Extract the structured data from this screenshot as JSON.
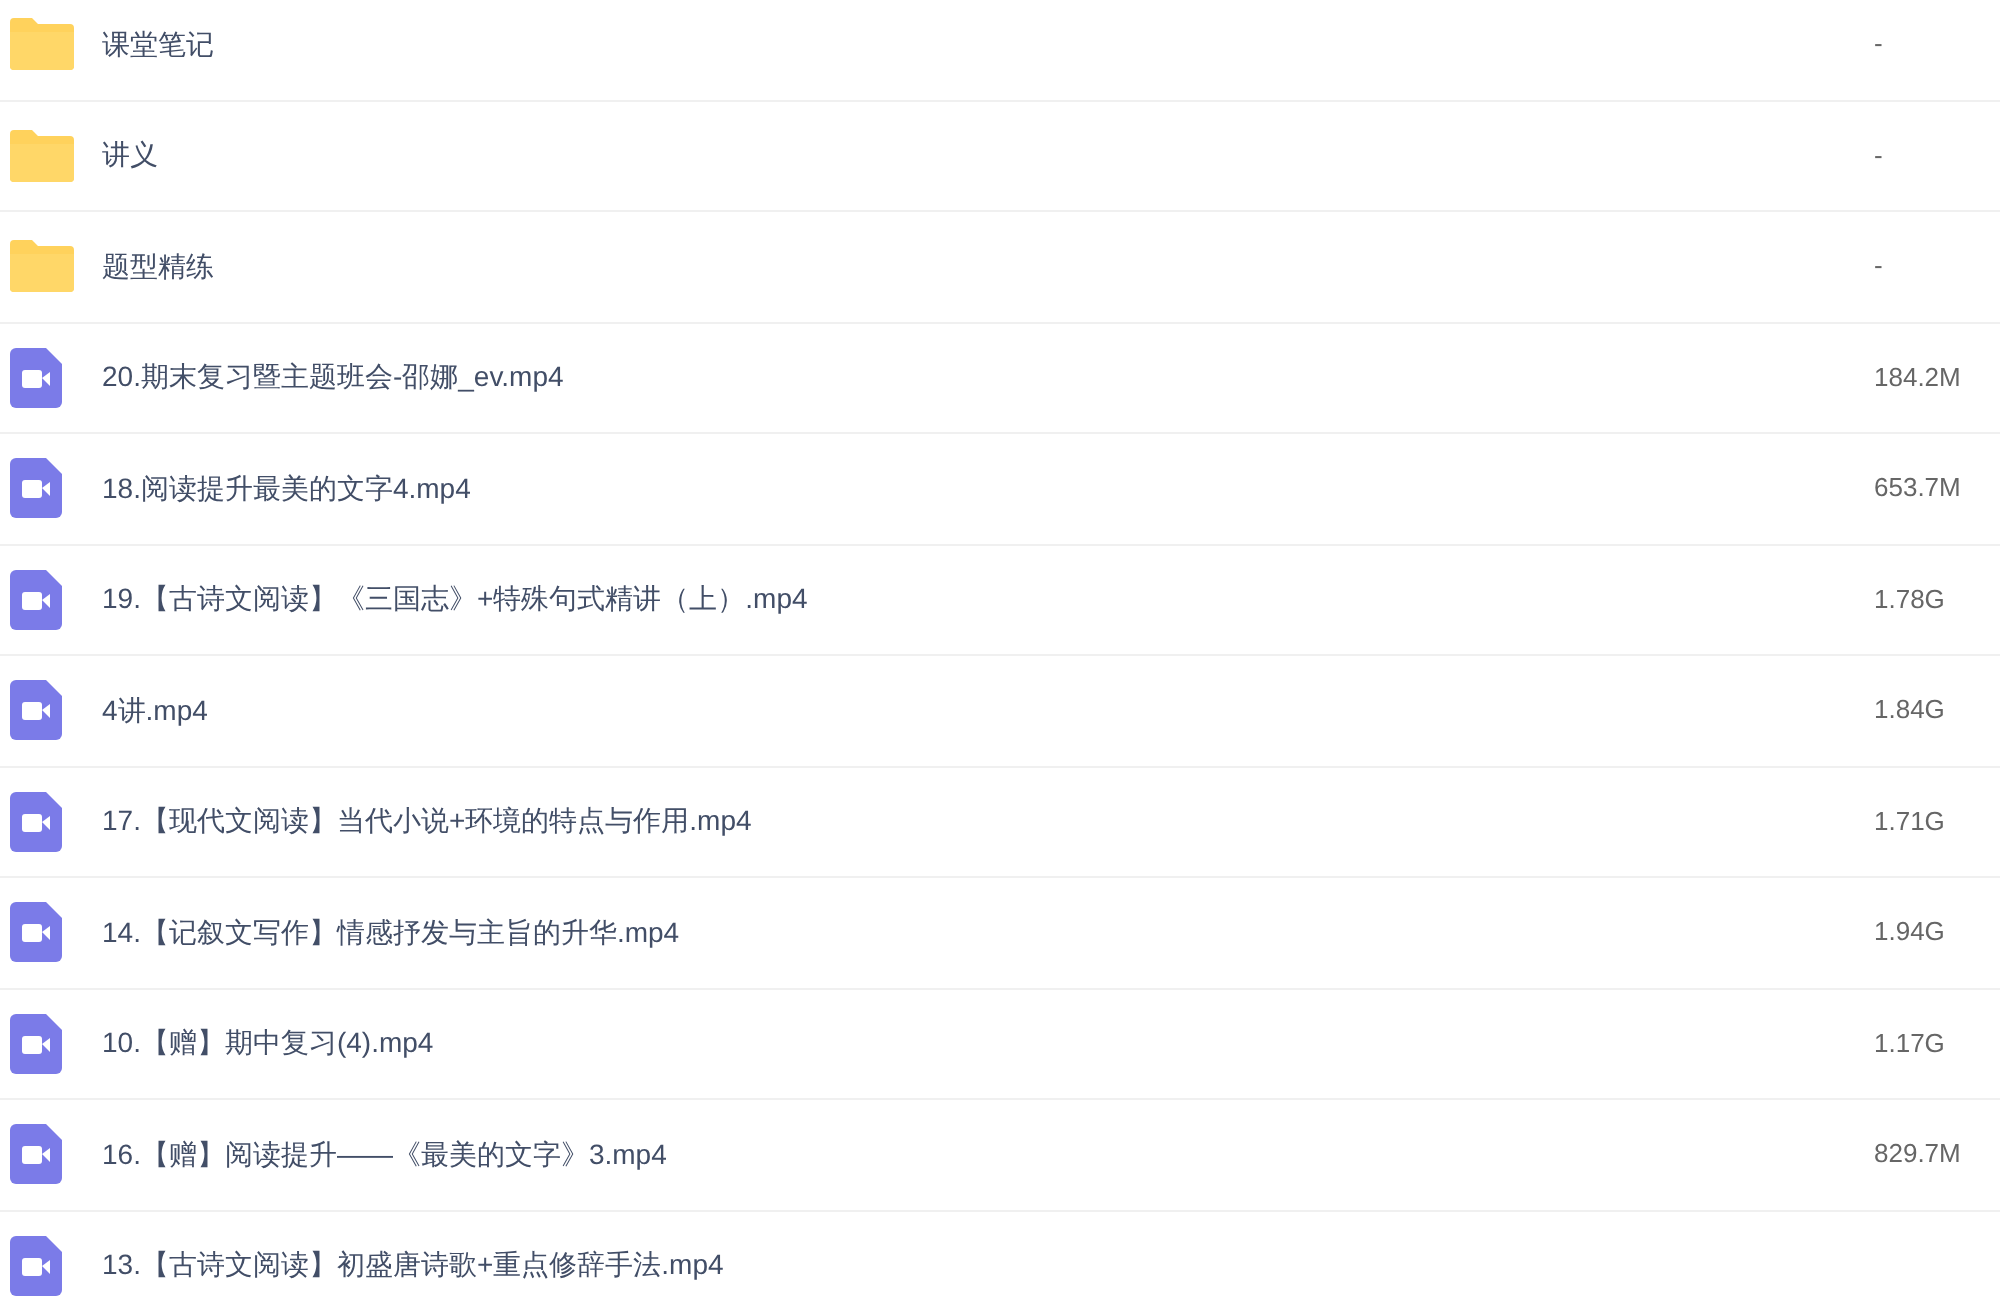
{
  "files": [
    {
      "kind": "folder",
      "name": "课堂笔记",
      "size": "-"
    },
    {
      "kind": "folder",
      "name": "讲义",
      "size": "-"
    },
    {
      "kind": "folder",
      "name": "题型精练",
      "size": "-"
    },
    {
      "kind": "video",
      "name": "20.期末复习暨主题班会-邵娜_ev.mp4",
      "size": "184.2M"
    },
    {
      "kind": "video",
      "name": "18.阅读提升最美的文字4.mp4",
      "size": "653.7M"
    },
    {
      "kind": "video",
      "name": "19.【古诗文阅读】《三国志》+特殊句式精讲（上）.mp4",
      "size": "1.78G"
    },
    {
      "kind": "video",
      "name": "4讲.mp4",
      "size": "1.84G"
    },
    {
      "kind": "video",
      "name": "17.【现代文阅读】当代小说+环境的特点与作用.mp4",
      "size": "1.71G"
    },
    {
      "kind": "video",
      "name": "14.【记叙文写作】情感抒发与主旨的升华.mp4",
      "size": "1.94G"
    },
    {
      "kind": "video",
      "name": "10.【赠】期中复习(4).mp4",
      "size": "1.17G"
    },
    {
      "kind": "video",
      "name": "16.【赠】阅读提升——《最美的文字》3.mp4",
      "size": "829.7M"
    },
    {
      "kind": "video",
      "name": "13.【古诗文阅读】初盛唐诗歌+重点修辞手法.mp4"
    }
  ]
}
